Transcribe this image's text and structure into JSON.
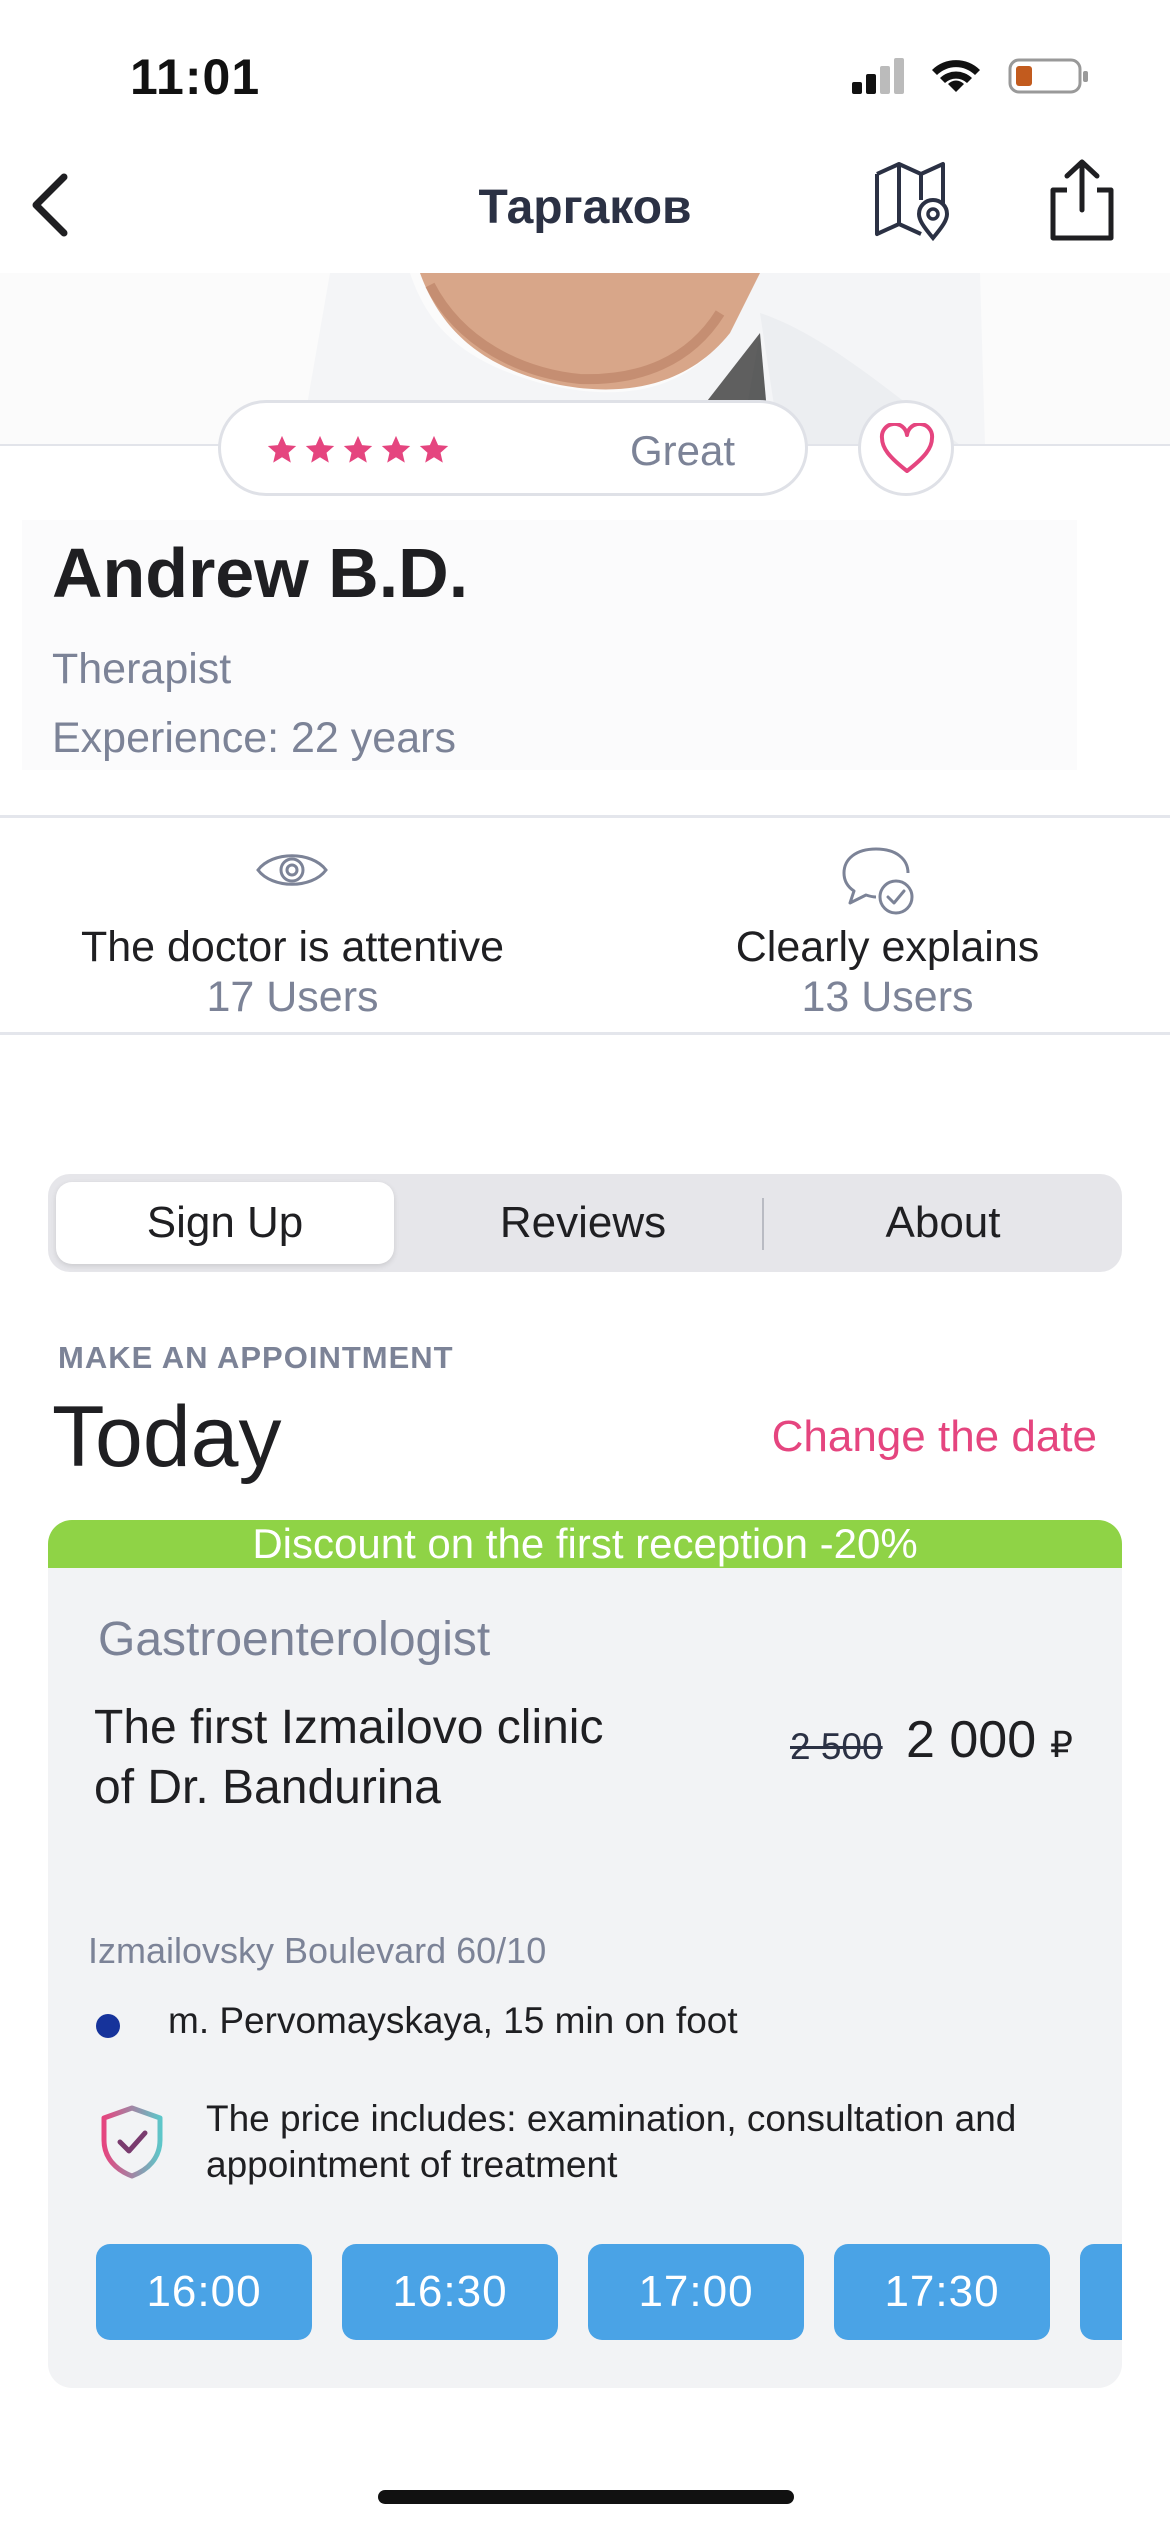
{
  "status_bar": {
    "time": "11:01"
  },
  "nav": {
    "title": "Таргаков",
    "back_icon": "chevron-left-icon",
    "map_icon": "map-pin-icon",
    "share_icon": "share-icon"
  },
  "rating": {
    "stars": 5,
    "max_stars": 5,
    "label": "Great",
    "star_color": "#e5457f"
  },
  "favorite": {
    "icon": "heart-icon"
  },
  "doctor": {
    "name": "Andrew B.D.",
    "specialty": "Therapist",
    "experience": "Experience: 22 years"
  },
  "traits": [
    {
      "icon": "eye-icon",
      "label": "The doctor is attentive",
      "count": "17 Users"
    },
    {
      "icon": "chat-check-icon",
      "label": "Clearly explains",
      "count": "13 Users"
    }
  ],
  "tabs": [
    {
      "label": "Sign Up",
      "active": true
    },
    {
      "label": "Reviews",
      "active": false
    },
    {
      "label": "About",
      "active": false
    }
  ],
  "appointment": {
    "section_label": "MAKE AN APPOINTMENT",
    "day": "Today",
    "change_date": "Change the date"
  },
  "offer": {
    "discount": "Discount on the first reception -20%",
    "specialty": "Gastroenterologist",
    "clinic": "The first Izmailovo clinic of Dr. Bandurina",
    "price_old": "2 500",
    "price_new": "2 000",
    "currency": "₽",
    "address": "Izmailovsky Boulevard 60/10",
    "metro": "m. Pervomayskaya, 15 min on foot",
    "includes": "The price includes: examination, consultation and appointment of treatment",
    "slots": [
      "16:00",
      "16:30",
      "17:00",
      "17:30"
    ]
  },
  "colors": {
    "accent_pink": "#e5457f",
    "discount_green": "#8fd346",
    "slot_blue": "#4aa3e6",
    "metro_blue": "#16339b",
    "muted_text": "#7c8397"
  }
}
